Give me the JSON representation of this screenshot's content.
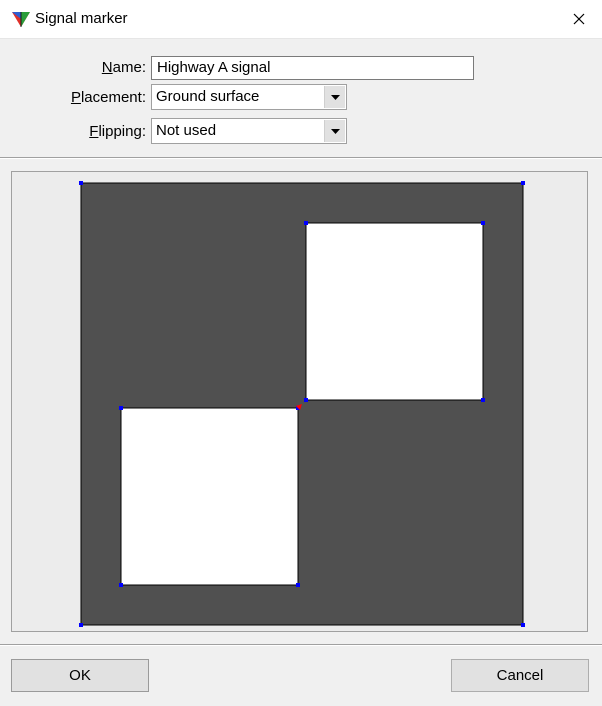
{
  "window": {
    "title": "Signal marker",
    "icon": "app-triangle-icon",
    "close_icon": "close-icon"
  },
  "form": {
    "name": {
      "label_key": "N",
      "label_rest": "ame:",
      "value": "Highway A signal"
    },
    "placement": {
      "label_key": "P",
      "label_rest": "lacement:",
      "value": "Ground surface"
    },
    "flipping": {
      "label_key": "F",
      "label_rest": "lipping:",
      "value": "Not used"
    }
  },
  "preview": {
    "background_color": "#505050",
    "square_color": "#ffffff",
    "vertex_color": "#0000ff",
    "origin_marker_color": "#ff0000"
  },
  "buttons": {
    "ok": "OK",
    "cancel": "Cancel"
  }
}
